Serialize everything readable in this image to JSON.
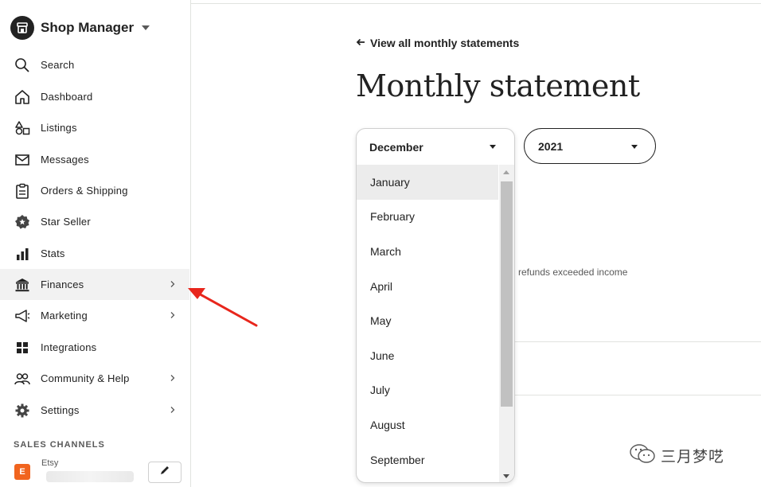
{
  "sidebar": {
    "brand": {
      "title": "Shop Manager"
    },
    "items": [
      {
        "label": "Search",
        "icon": "search-icon"
      },
      {
        "label": "Dashboard",
        "icon": "home-icon"
      },
      {
        "label": "Listings",
        "icon": "shapes-icon"
      },
      {
        "label": "Messages",
        "icon": "envelope-icon"
      },
      {
        "label": "Orders & Shipping",
        "icon": "clipboard-icon"
      },
      {
        "label": "Star Seller",
        "icon": "star-badge-icon"
      },
      {
        "label": "Stats",
        "icon": "bar-chart-icon"
      },
      {
        "label": "Finances",
        "icon": "bank-icon",
        "active": true,
        "chevron": true
      },
      {
        "label": "Marketing",
        "icon": "megaphone-icon",
        "chevron": true
      },
      {
        "label": "Integrations",
        "icon": "grid-icon"
      },
      {
        "label": "Community & Help",
        "icon": "people-icon",
        "chevron": true
      },
      {
        "label": "Settings",
        "icon": "gear-icon",
        "chevron": true
      }
    ],
    "sales_channels_heading": "SALES CHANNELS",
    "etsy_channel": {
      "badge": "E",
      "label": "Etsy"
    }
  },
  "main": {
    "back_link": "View all monthly statements",
    "title": "Monthly statement",
    "month_select": {
      "selected": "December",
      "options": [
        "January",
        "February",
        "March",
        "April",
        "May",
        "June",
        "July",
        "August",
        "September"
      ],
      "highlighted": "January"
    },
    "year_select": {
      "selected": "2021"
    },
    "refund_note": "refunds exceeded income"
  },
  "watermark": {
    "text": "三月梦呓"
  },
  "colors": {
    "accent": "#f1641e",
    "annotation_arrow": "#e8261c",
    "text": "#222222"
  }
}
